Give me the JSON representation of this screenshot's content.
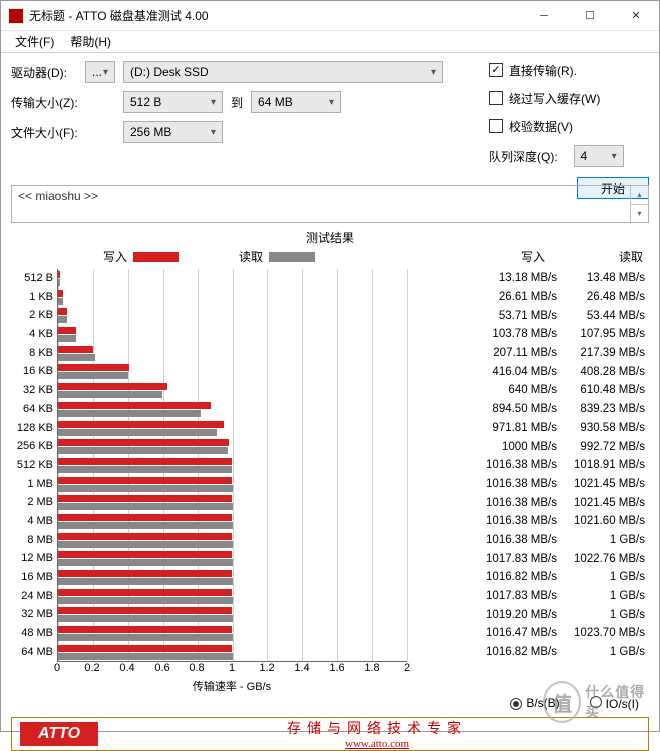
{
  "window": {
    "title": "无标题 - ATTO 磁盘基准测试 4.00"
  },
  "menu": {
    "file": "文件(F)",
    "help": "帮助(H)"
  },
  "labels": {
    "drive": "驱动器(D):",
    "transfer_size": "传输大小(Z):",
    "file_size": "文件大小(F):",
    "to": "到",
    "direct_io": "直接传输(R).",
    "bypass_cache": "绕过写入缓存(W)",
    "verify": "校验数据(V)",
    "queue_depth": "队列深度(Q):",
    "start": "开始",
    "results_title": "测试结果",
    "legend_write": "写入",
    "legend_read": "读取",
    "col_write": "写入",
    "col_read": "读取",
    "x_unit": "传输速率 - GB/s",
    "radio_bs": "B/s(B)",
    "radio_ios": "IO/s(I)"
  },
  "values": {
    "drive_combo_small": "...",
    "drive_combo": "(D:) Desk SSD",
    "min_size": "512 B",
    "max_size": "64 MB",
    "file_size": "256 MB",
    "queue_depth": "4",
    "miaoshu": "<< miaoshu >>"
  },
  "checks": {
    "direct_io": true,
    "bypass_cache": false,
    "verify": false
  },
  "radio": {
    "bs": true,
    "ios": false
  },
  "footer": {
    "logo": "ATTO",
    "line1": "存储与网络技术专家",
    "line2": "www.atto.com"
  },
  "watermark": {
    "char": "值",
    "text": "什么值得买"
  },
  "chart_data": {
    "type": "bar",
    "orientation": "horizontal",
    "xlabel": "传输速率 - GB/s",
    "xlim": [
      0,
      2
    ],
    "xticks": [
      0,
      0.2,
      0.4,
      0.6,
      0.8,
      1,
      1.2,
      1.4,
      1.6,
      1.8,
      2
    ],
    "categories": [
      "512 B",
      "1 KB",
      "2 KB",
      "4 KB",
      "8 KB",
      "16 KB",
      "32 KB",
      "64 KB",
      "128 KB",
      "256 KB",
      "512 KB",
      "1 MB",
      "2 MB",
      "4 MB",
      "8 MB",
      "12 MB",
      "16 MB",
      "24 MB",
      "32 MB",
      "48 MB",
      "64 MB"
    ],
    "series": [
      {
        "name": "写入",
        "color": "#d42020",
        "display": [
          "13.18 MB/s",
          "26.61 MB/s",
          "53.71 MB/s",
          "103.78 MB/s",
          "207.11 MB/s",
          "416.04 MB/s",
          "640 MB/s",
          "894.50 MB/s",
          "971.81 MB/s",
          "1000 MB/s",
          "1016.38 MB/s",
          "1016.38 MB/s",
          "1016.38 MB/s",
          "1016.38 MB/s",
          "1016.38 MB/s",
          "1017.83 MB/s",
          "1016.82 MB/s",
          "1017.83 MB/s",
          "1019.20 MB/s",
          "1016.47 MB/s",
          "1016.82 MB/s"
        ],
        "values_mb_s": [
          13.18,
          26.61,
          53.71,
          103.78,
          207.11,
          416.04,
          640,
          894.5,
          971.81,
          1000,
          1016.38,
          1016.38,
          1016.38,
          1016.38,
          1016.38,
          1017.83,
          1016.82,
          1017.83,
          1019.2,
          1016.47,
          1016.82
        ]
      },
      {
        "name": "读取",
        "color": "#888888",
        "display": [
          "13.48 MB/s",
          "26.48 MB/s",
          "53.44 MB/s",
          "107.95 MB/s",
          "217.39 MB/s",
          "408.28 MB/s",
          "610.48 MB/s",
          "839.23 MB/s",
          "930.58 MB/s",
          "992.72 MB/s",
          "1018.91 MB/s",
          "1021.45 MB/s",
          "1021.45 MB/s",
          "1021.60 MB/s",
          "1 GB/s",
          "1022.76 MB/s",
          "1 GB/s",
          "1 GB/s",
          "1 GB/s",
          "1023.70 MB/s",
          "1 GB/s"
        ],
        "values_mb_s": [
          13.48,
          26.48,
          53.44,
          107.95,
          217.39,
          408.28,
          610.48,
          839.23,
          930.58,
          992.72,
          1018.91,
          1021.45,
          1021.45,
          1021.6,
          1024,
          1022.76,
          1024,
          1024,
          1024,
          1023.7,
          1024
        ]
      }
    ]
  }
}
